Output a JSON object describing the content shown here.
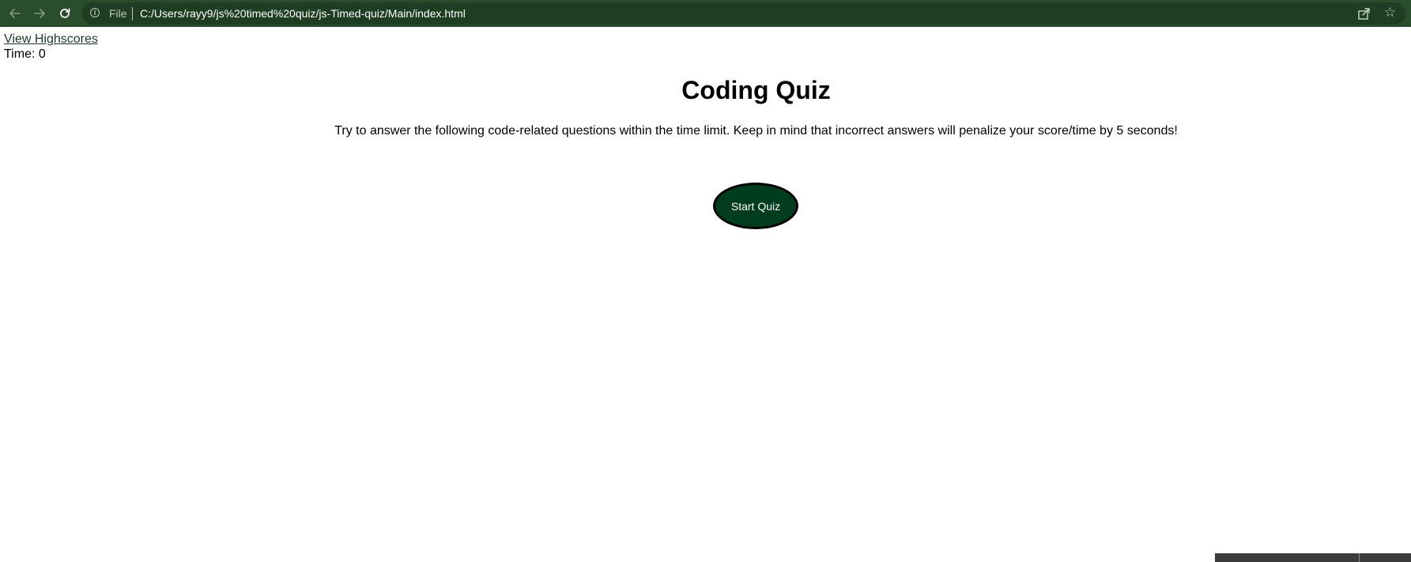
{
  "browser": {
    "back_icon": "arrow-left-icon",
    "forward_icon": "arrow-right-icon",
    "reload_icon": "reload-icon",
    "site_info_icon": "info-icon",
    "scheme_label": "File",
    "url": "C:/Users/rayy9/js%20timed%20quiz/js-Timed-quiz/Main/index.html",
    "share_icon": "share-icon",
    "bookmark_icon": "star-icon",
    "bar_color": "#2a4d2c"
  },
  "page": {
    "highscores_link": "View Highscores",
    "timer_label": "Time: ",
    "timer_value": "0",
    "title": "Coding Quiz",
    "description": "Try to answer the following code-related questions within the time limit. Keep in mind that incorrect answers will penalize your score/time by 5 seconds!",
    "start_button": "Start Quiz",
    "button_color": "#003d1e",
    "link_color": "#1b3a23"
  }
}
